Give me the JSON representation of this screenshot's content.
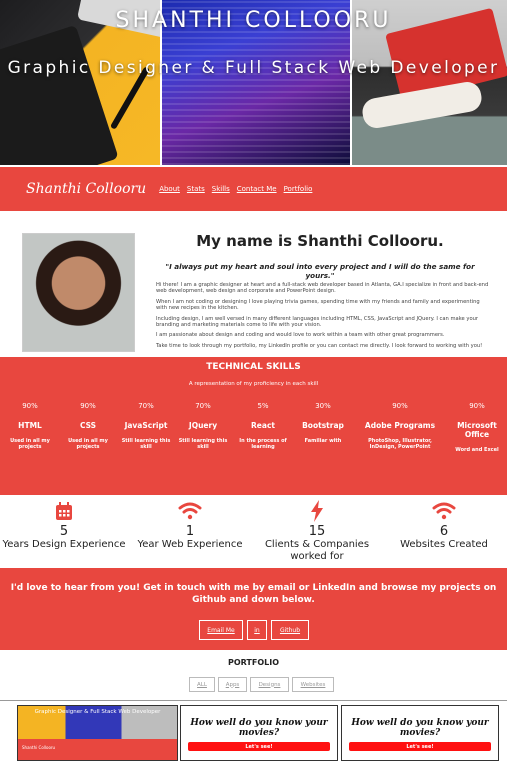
{
  "hero": {
    "title": "SHANTHI COLLOORU",
    "subtitle": "Graphic Designer & Full Stack Web Developer"
  },
  "nav": {
    "brand": "Shanthi Collooru",
    "links": [
      "About",
      "Stats",
      "Skills",
      "Contact Me",
      "Portfolio"
    ]
  },
  "about": {
    "heading": "My name is Shanthi Collooru.",
    "quote": "\"I always put my heart and soul into every project and I will do the same for yours.\"",
    "paragraphs": [
      "Hi there! I am a graphic designer at heart and a full-stack web developer based in Atlanta, GA.I specialize in front and back-end web development, web design and corporate and PowerPoint design.",
      "When I am not coding or designing I love playing trivia games, spending time with my friends and family and experimenting with new recipes in the kitchen.",
      "Including design, I am well versed in many different languages including HTML, CSS, JavaScript and JQuery. I can make your branding and marketing materials come to life with your vision.",
      "I am passionate about design and coding and would love to work within a team with other great programmers.",
      "Take time to look through my portfolio, my LinkedIn profile or you can contact me directly. I look forward to working with you!"
    ]
  },
  "skills": {
    "title": "TECHNICAL SKILLS",
    "subtitle": "A representation of my proficiency in each skill",
    "items": [
      {
        "pct": "90%",
        "name": "HTML",
        "desc": "Used in all my projects"
      },
      {
        "pct": "90%",
        "name": "CSS",
        "desc": "Used in all my projects"
      },
      {
        "pct": "70%",
        "name": "JavaScript",
        "desc": "Still learning this skill"
      },
      {
        "pct": "70%",
        "name": "JQuery",
        "desc": "Still learning this skill"
      },
      {
        "pct": "5%",
        "name": "React",
        "desc": "In the process of learning"
      },
      {
        "pct": "30%",
        "name": "Bootstrap",
        "desc": "Familiar with"
      },
      {
        "pct": "90%",
        "name": "Adobe Programs",
        "desc": "PhotoShop, Illustrator, InDesign, PowerPoint"
      },
      {
        "pct": "90%",
        "name": "Microsoft Office",
        "desc": "Word and Excel"
      }
    ]
  },
  "stats": [
    {
      "icon": "calendar-icon",
      "num": "5",
      "label": "Years Design Experience"
    },
    {
      "icon": "wifi-icon",
      "num": "1",
      "label": "Year Web Experience"
    },
    {
      "icon": "lightning-icon",
      "num": "15",
      "label": "Clients & Companies worked for"
    },
    {
      "icon": "wifi-icon",
      "num": "6",
      "label": "Websites Created"
    }
  ],
  "contact": {
    "text": "I'd love to hear from you! Get in touch with me by email or LinkedIn and browse my projects on Github and down below.",
    "buttons": [
      "Email Me",
      "in",
      "Github"
    ]
  },
  "portfolio": {
    "title": "PORTFOLIO",
    "filters": [
      "ALL",
      "Apps",
      "Designs",
      "Websites"
    ],
    "cards": [
      {
        "title": "Graphic Designer & Full Stack Web Developer",
        "nav": "Shanthi Collooru"
      },
      {
        "title": "How well do you know your movies?",
        "button": "Let's see!"
      },
      {
        "title": "How well do you know your movies?",
        "button": "Let's see!"
      }
    ]
  },
  "colors": {
    "accent": "#e8473f"
  }
}
